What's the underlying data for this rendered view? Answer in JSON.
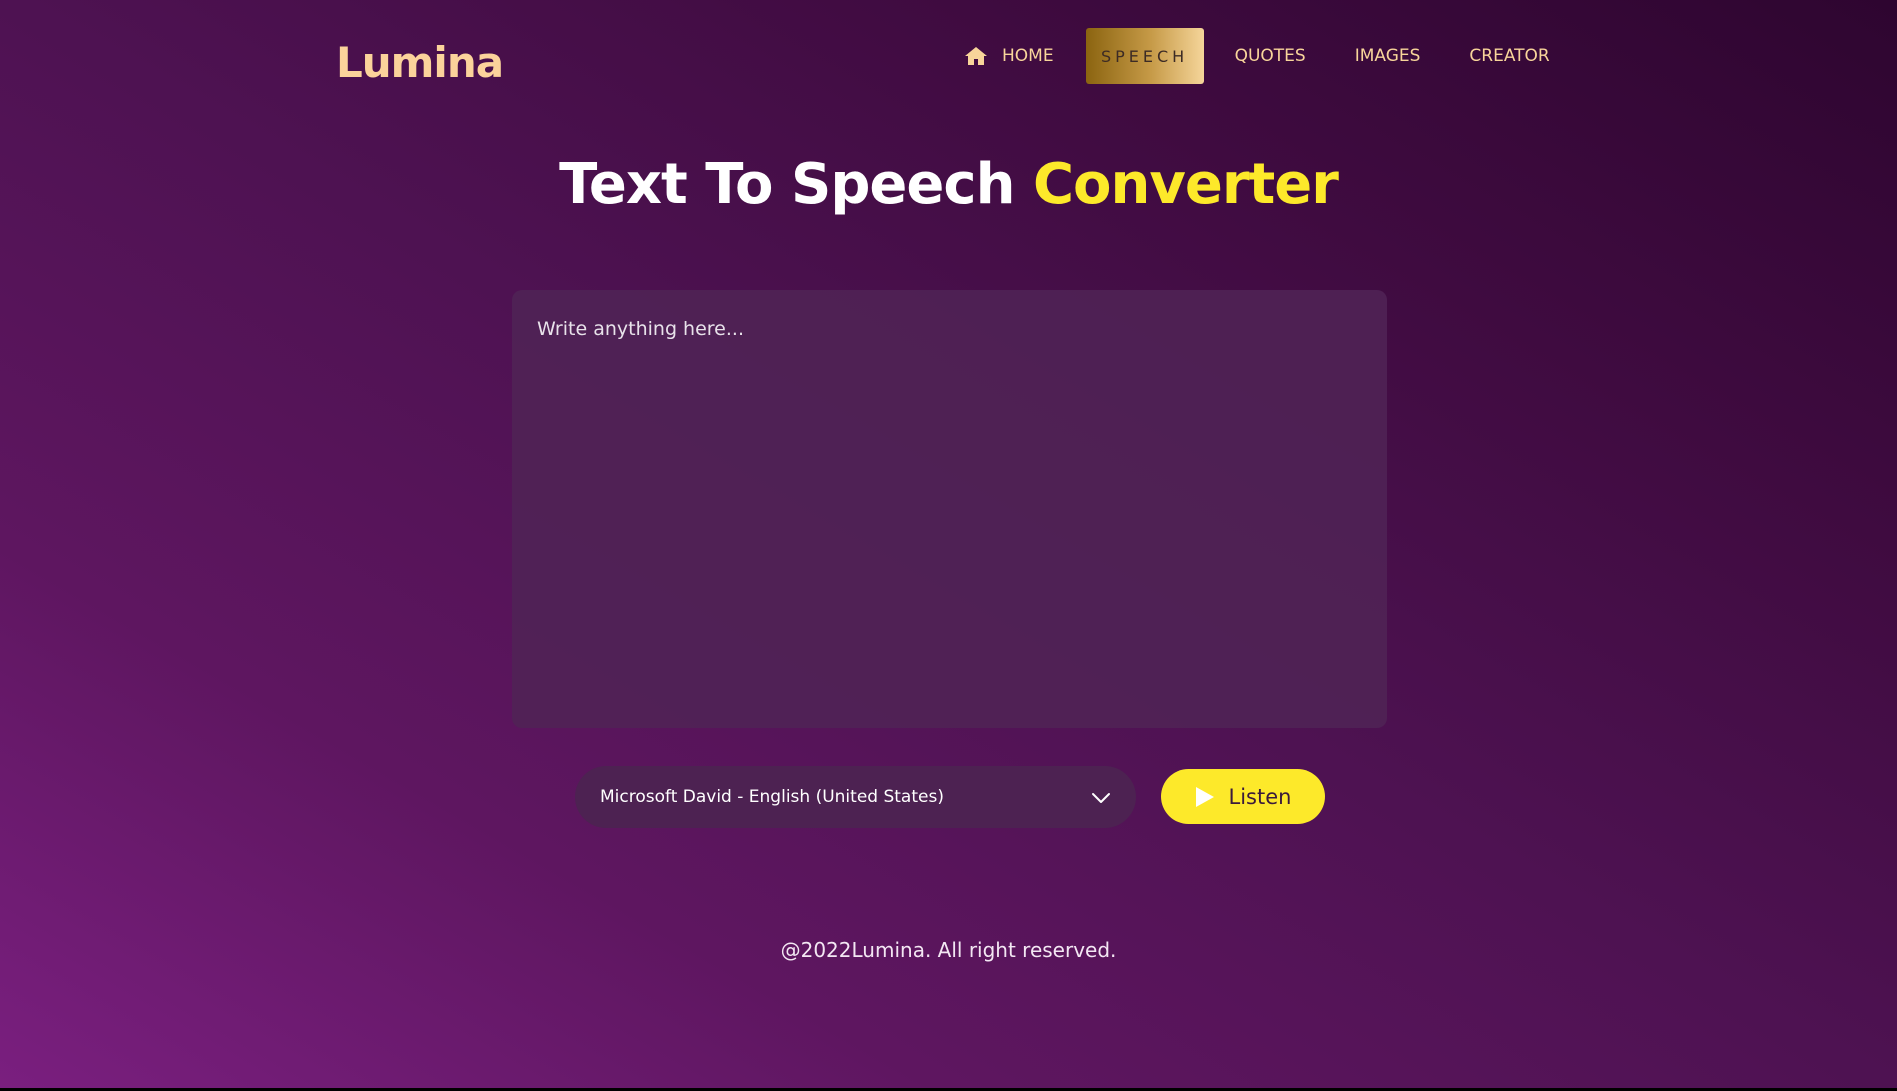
{
  "header": {
    "logo": "Lumina",
    "nav": [
      {
        "label": "HOME",
        "icon": "home-icon",
        "active": false
      },
      {
        "label": "SPEECH",
        "active": true
      },
      {
        "label": "QUOTES",
        "active": false
      },
      {
        "label": "IMAGES",
        "active": false
      },
      {
        "label": "CREATOR",
        "active": false
      }
    ]
  },
  "main": {
    "title_part1": "Text To Speech",
    "title_part2": "Converter",
    "text_input": {
      "placeholder": "Write anything here...",
      "value": ""
    },
    "voice_select": {
      "selected": "Microsoft David - English (United States)",
      "icon": "chevron-down-icon"
    },
    "listen_button": {
      "label": "Listen",
      "icon": "play-icon"
    }
  },
  "footer": {
    "text": "@2022Lumina. All right reserved."
  },
  "colors": {
    "accent_yellow": "#fde92a",
    "logo_gold": "#fbd39b",
    "nav_text": "#f8d59a",
    "background_start": "#7a1f7f",
    "background_end": "#2e0530",
    "panel": "#4d2252"
  }
}
